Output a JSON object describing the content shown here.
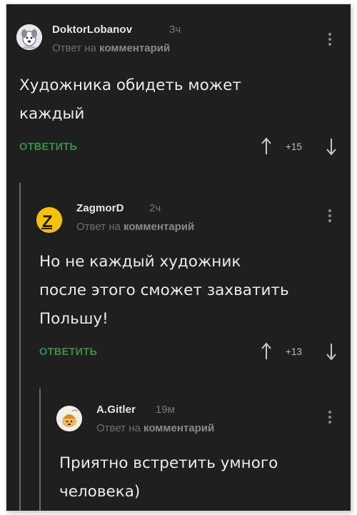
{
  "comments": [
    {
      "username": "DoktorLobanov",
      "time": "3ч",
      "reply_prefix": "Ответ на",
      "reply_target": "комментарий",
      "text_lines": [
        "Художника обидеть может",
        "каждый"
      ],
      "reply_action": "ОТВЕТИТЬ",
      "score": "+15",
      "avatar_icon": "dog-avatar-icon"
    },
    {
      "username": "ZagmorD",
      "time": "2ч",
      "reply_prefix": "Ответ на",
      "reply_target": "комментарий",
      "text_lines": [
        "Но не каждый художник",
        "после этого сможет захватить",
        "Польшу!"
      ],
      "reply_action": "ОТВЕТИТЬ",
      "score": "+13",
      "avatar_letter": "Z",
      "avatar_color": "#f4c20d"
    },
    {
      "username": "A.Gitler",
      "time": "19м",
      "reply_prefix": "Ответ на",
      "reply_target": "комментарий",
      "text_lines": [
        "Приятно встретить умного",
        "человека)"
      ],
      "avatar_icon": "cartoon-avatar-icon"
    }
  ],
  "colors": {
    "background": "#1f1f20",
    "accent_green": "#3d8d49",
    "thread_line": "#6b6b6b"
  }
}
